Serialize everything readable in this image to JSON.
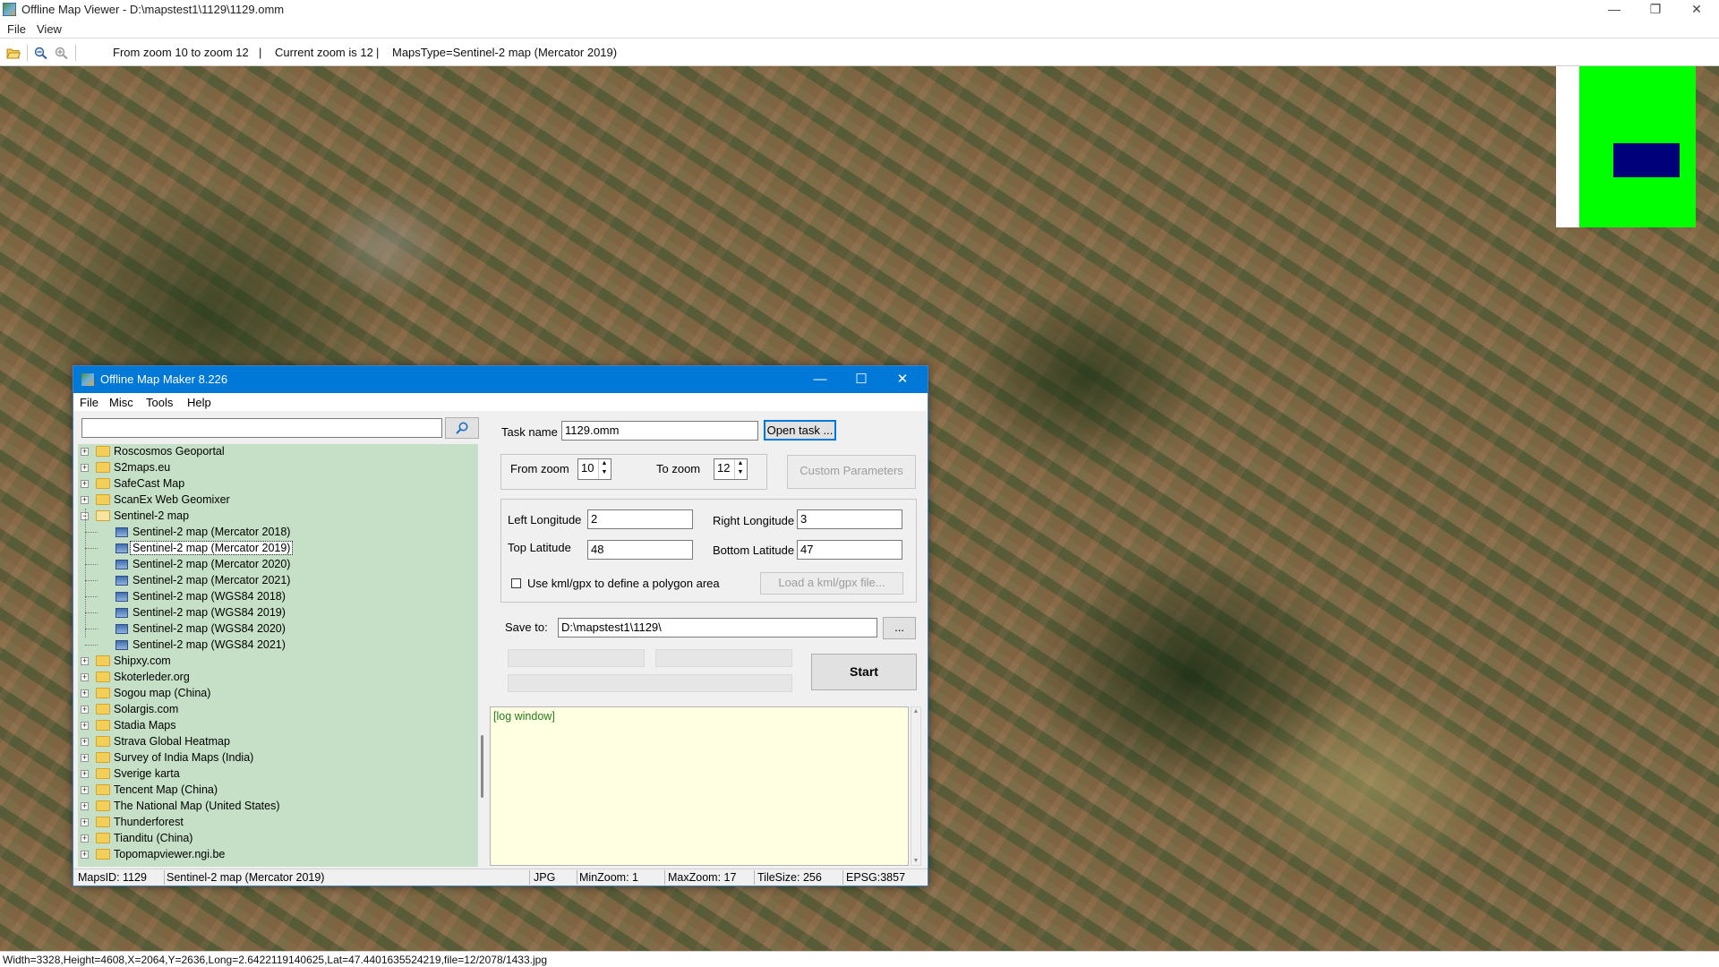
{
  "window": {
    "title": "Offline Map Viewer - D:\\mapstest1\\1129\\1129.omm",
    "controls": {
      "minimize": "—",
      "restore": "❐",
      "close": "✕"
    }
  },
  "menu": {
    "file": "File",
    "view": "View"
  },
  "toolbar": {
    "icons": [
      "open-folder-icon",
      "zoom-out-icon",
      "zoom-in-icon"
    ],
    "zoom_range": "From zoom 10 to zoom 12",
    "current_zoom": "Current zoom is 12",
    "maps_type": "MapsType=Sentinel-2 map (Mercator 2019)",
    "separator": "|"
  },
  "overview": {
    "bg_color": "#00ff00",
    "box_color": "#00007a"
  },
  "status_bar": "Width=3328,Height=4608,X=2064,Y=2636,Long=2.6422119140625,Lat=47.4401635524219,file=12/2078/1433.jpg",
  "dialog": {
    "title": "Offline Map Maker 8.226",
    "controls": {
      "minimize": "—",
      "maximize": "☐",
      "close": "✕"
    },
    "menu": [
      "File",
      "Misc",
      "Tools",
      "Help"
    ],
    "search": {
      "value": "",
      "icon": "search-icon"
    },
    "tree": [
      {
        "label": "Roscosmos Geoportal",
        "type": "folder",
        "expanded": false
      },
      {
        "label": "S2maps.eu",
        "type": "folder",
        "expanded": false
      },
      {
        "label": "SafeCast Map",
        "type": "folder",
        "expanded": false
      },
      {
        "label": "ScanEx Web Geomixer",
        "type": "folder",
        "expanded": false
      },
      {
        "label": "Sentinel-2 map",
        "type": "folder",
        "expanded": true
      },
      {
        "label": "Sentinel-2 map (Mercator 2018)",
        "type": "map",
        "child": true
      },
      {
        "label": "Sentinel-2 map (Mercator 2019)",
        "type": "map",
        "child": true,
        "selected": true
      },
      {
        "label": "Sentinel-2 map (Mercator 2020)",
        "type": "map",
        "child": true
      },
      {
        "label": "Sentinel-2 map (Mercator 2021)",
        "type": "map",
        "child": true
      },
      {
        "label": "Sentinel-2 map (WGS84 2018)",
        "type": "map",
        "child": true
      },
      {
        "label": "Sentinel-2 map (WGS84 2019)",
        "type": "map",
        "child": true
      },
      {
        "label": "Sentinel-2 map (WGS84 2020)",
        "type": "map",
        "child": true
      },
      {
        "label": "Sentinel-2 map (WGS84 2021)",
        "type": "map",
        "child": true
      },
      {
        "label": "Shipxy.com",
        "type": "folder",
        "expanded": false
      },
      {
        "label": "Skoterleder.org",
        "type": "folder",
        "expanded": false
      },
      {
        "label": "Sogou map (China)",
        "type": "folder",
        "expanded": false
      },
      {
        "label": "Solargis.com",
        "type": "folder",
        "expanded": false
      },
      {
        "label": "Stadia Maps",
        "type": "folder",
        "expanded": false
      },
      {
        "label": "Strava Global Heatmap",
        "type": "folder",
        "expanded": false
      },
      {
        "label": "Survey of India Maps (India)",
        "type": "folder",
        "expanded": false
      },
      {
        "label": "Sverige karta",
        "type": "folder",
        "expanded": false
      },
      {
        "label": "Tencent Map (China)",
        "type": "folder",
        "expanded": false
      },
      {
        "label": "The National Map (United States)",
        "type": "folder",
        "expanded": false
      },
      {
        "label": "Thunderforest",
        "type": "folder",
        "expanded": false
      },
      {
        "label": "Tianditu (China)",
        "type": "folder",
        "expanded": false
      },
      {
        "label": "Topomapviewer.ngi.be",
        "type": "folder",
        "expanded": false
      }
    ],
    "task_name_label": "Task name",
    "task_name_value": "1129.omm",
    "open_task_button": "Open task ...",
    "from_zoom_label": "From zoom",
    "from_zoom_value": "10",
    "to_zoom_label": "To zoom",
    "to_zoom_value": "12",
    "custom_parameters_button": "Custom Parameters",
    "left_longitude_label": "Left Longitude",
    "left_longitude_value": "2",
    "right_longitude_label": "Right Longitude",
    "right_longitude_value": "3",
    "top_latitude_label": "Top Latitude",
    "top_latitude_value": "48",
    "bottom_latitude_label": "Bottom Latitude",
    "bottom_latitude_value": "47",
    "kml_checkbox_label": "Use kml/gpx to define a polygon area",
    "kml_checkbox_checked": false,
    "load_kml_button": "Load a kml/gpx file...",
    "save_to_label": "Save to:",
    "save_to_value": "D:\\mapstest1\\1129\\",
    "browse_button": "...",
    "start_button": "Start",
    "log_text": "[log window]",
    "status": {
      "maps_id": "MapsID: 1129",
      "map_name": "Sentinel-2 map (Mercator 2019)",
      "format": "JPG",
      "min_zoom": "MinZoom: 1",
      "max_zoom": "MaxZoom: 17",
      "tile_size": "TileSize: 256",
      "epsg": "EPSG:3857"
    }
  }
}
